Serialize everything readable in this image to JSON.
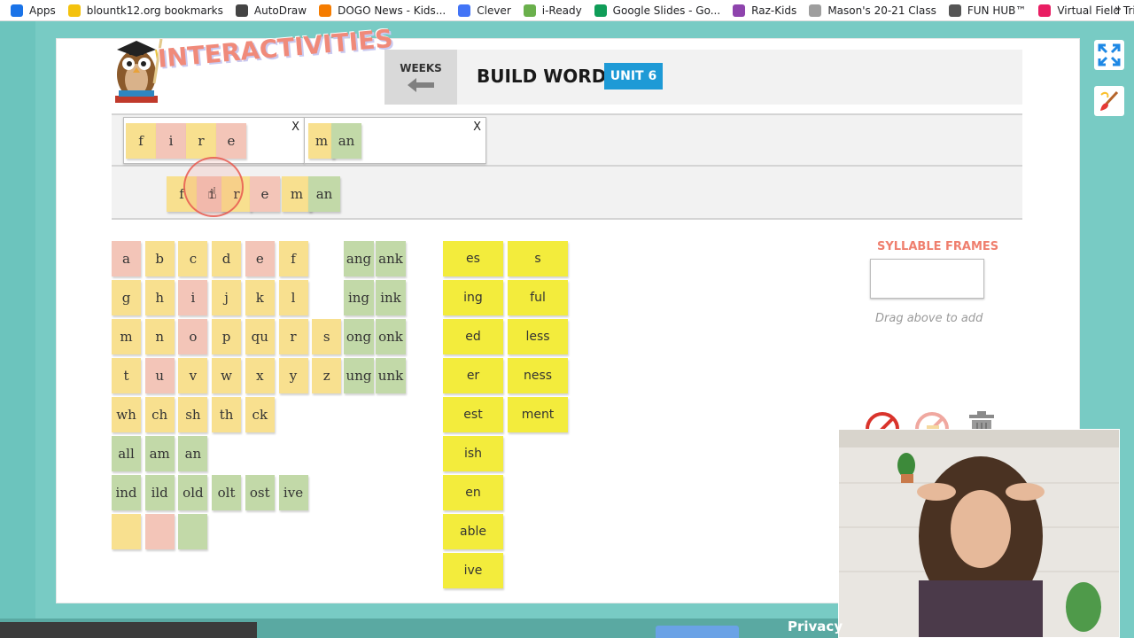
{
  "bookmarks": [
    {
      "label": "Apps",
      "icon": "apps-grid-icon",
      "color": "#1a73e8"
    },
    {
      "label": "blountk12.org bookmarks",
      "icon": "folder-icon",
      "color": "#f4c20d"
    },
    {
      "label": "AutoDraw",
      "icon": "autodraw-icon",
      "color": "#444444"
    },
    {
      "label": "DOGO News - Kids...",
      "icon": "dogo-icon",
      "color": "#f57c00"
    },
    {
      "label": "Clever",
      "icon": "clever-icon",
      "color": "#4274f6"
    },
    {
      "label": "i-Ready",
      "icon": "iready-icon",
      "color": "#6ab04c"
    },
    {
      "label": "Google Slides - Go...",
      "icon": "google-drive-icon",
      "color": "#0f9d58"
    },
    {
      "label": "Raz-Kids",
      "icon": "raz-kids-icon",
      "color": "#8e44ad"
    },
    {
      "label": "Mason's 20-21 Class",
      "icon": "page-icon",
      "color": "#9e9e9e"
    },
    {
      "label": "FUN HUB™",
      "icon": "fun-hub-icon",
      "color": "#555555"
    },
    {
      "label": "Virtual Field Trips fo...",
      "icon": "pin-icon",
      "color": "#e91e63"
    }
  ],
  "bookmarks_more": "»",
  "logo_text": "INTERACTIVITIES",
  "header": {
    "weeks_label": "WEEKS",
    "title": "BUILD WORDS",
    "unit_label": "UNIT 6"
  },
  "build_frames": [
    {
      "close": "X",
      "tiles": [
        [
          "f",
          "y"
        ],
        [
          "i",
          "p"
        ],
        [
          "r",
          "y"
        ],
        [
          "e",
          "p"
        ]
      ]
    },
    {
      "close": "X",
      "tiles": [
        [
          "m",
          "y"
        ],
        [
          "an",
          "g"
        ]
      ]
    }
  ],
  "result_tiles": [
    [
      "f",
      "y"
    ],
    [
      "i",
      "p"
    ],
    [
      "r",
      "y"
    ],
    [
      "e",
      "p"
    ],
    [
      "m",
      "y"
    ],
    [
      "an",
      "g"
    ]
  ],
  "letters": {
    "row1": [
      [
        "a",
        "p"
      ],
      [
        "b",
        "y"
      ],
      [
        "c",
        "y"
      ],
      [
        "d",
        "y"
      ],
      [
        "e",
        "p"
      ],
      [
        "f",
        "y"
      ]
    ],
    "row2": [
      [
        "g",
        "y"
      ],
      [
        "h",
        "y"
      ],
      [
        "i",
        "p"
      ],
      [
        "j",
        "y"
      ],
      [
        "k",
        "y"
      ],
      [
        "l",
        "y"
      ]
    ],
    "row3": [
      [
        "m",
        "y"
      ],
      [
        "n",
        "y"
      ],
      [
        "o",
        "p"
      ],
      [
        "p",
        "y"
      ],
      [
        "qu",
        "y"
      ],
      [
        "r",
        "y"
      ],
      [
        "s",
        "y"
      ]
    ],
    "row4": [
      [
        "t",
        "y"
      ],
      [
        "u",
        "p"
      ],
      [
        "v",
        "y"
      ],
      [
        "w",
        "y"
      ],
      [
        "x",
        "y"
      ],
      [
        "y",
        "y"
      ],
      [
        "z",
        "y"
      ]
    ],
    "row5": [
      [
        "wh",
        "y"
      ],
      [
        "ch",
        "y"
      ],
      [
        "sh",
        "y"
      ],
      [
        "th",
        "y"
      ],
      [
        "ck",
        "y"
      ]
    ],
    "row6": [
      [
        "all",
        "g"
      ],
      [
        "am",
        "g"
      ],
      [
        "an",
        "g"
      ]
    ],
    "row7": [
      [
        "ind",
        "g"
      ],
      [
        "ild",
        "g"
      ],
      [
        "old",
        "g"
      ],
      [
        "olt",
        "g"
      ],
      [
        "ost",
        "g"
      ],
      [
        "ive",
        "g"
      ]
    ],
    "row8": [
      [
        "",
        "y"
      ],
      [
        "",
        "p"
      ],
      [
        "",
        "g"
      ]
    ]
  },
  "glued": [
    [
      "ang",
      "ank"
    ],
    [
      "ing",
      "ink"
    ],
    [
      "ong",
      "onk"
    ],
    [
      "ung",
      "unk"
    ]
  ],
  "suffixes_col1": [
    "es",
    "ing",
    "ed",
    "er",
    "est",
    "ish",
    "en",
    "able",
    "ive"
  ],
  "suffixes_col2": [
    "s",
    "ful",
    "less",
    "ness",
    "ment"
  ],
  "syllable_frames": {
    "label": "SYLLABLE FRAMES",
    "hint": "Drag above to add"
  },
  "footer": {
    "privacy": "Privacy"
  },
  "colors": {
    "yellow_tile": "#f8e08f",
    "pink_tile": "#f3c5b8",
    "green_tile": "#c2d9a8",
    "suffix_tile": "#f3ec3c",
    "unit_badge": "#1e9ad6",
    "syllable_label": "#ef7f6e"
  }
}
